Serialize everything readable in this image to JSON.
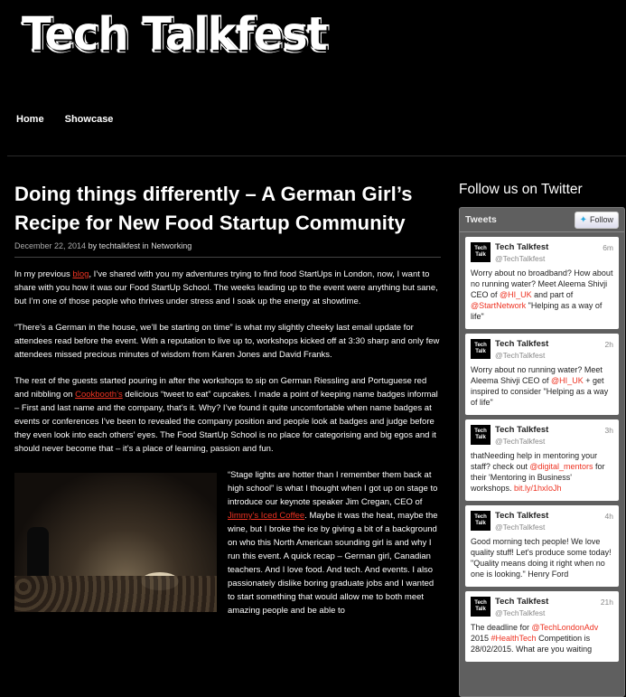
{
  "site": {
    "logo_text": "Tech Talkfest"
  },
  "nav": {
    "items": [
      "Home",
      "Showcase"
    ]
  },
  "post": {
    "title": "Doing things differently – A German Girl’s Recipe for New Food Startup Community",
    "date": "December 22, 2014",
    "by": "by",
    "author": "techtalkfest",
    "in": "in",
    "category": "Networking",
    "p1_a": "In my previous ",
    "p1_link": "blog",
    "p1_b": ", I’ve shared with you my adventures trying to find food StartUps in London, now, I want to share with you how it was our Food StartUp School. The weeks leading up to the event were anything but sane, but I’m one of those people who thrives under stress and I soak up the energy at showtime.",
    "p2": "“There’s a German in the house, we’ll be starting on time” is what my slightly cheeky last email update for attendees read before the event. With a reputation to live up to, workshops kicked off at 3:30 sharp and only few attendees missed precious minutes of wisdom from Karen Jones and David Franks.",
    "p3_a": "The rest of the guests started pouring in after the workshops to sip on German Riessling and Portuguese red and nibbling on ",
    "p3_link": "Cookbooth’s",
    "p3_b": " delicious “tweet to eat” cupcakes. I made a point of keeping name badges informal – First and last name and the company, that’s it. Why? I’ve found it quite uncomfortable when name badges at events or conferences I’ve been to revealed the company position and  people look at badges and judge before they even look into each others’ eyes. The Food StartUp School is no place for categorising and big egos and it should never become that – it’s a place of learning, passion and fun.",
    "p4_a": "“Stage lights are hotter than I remember them back at high school” is what I thought when I got up on stage to introduce our keynote speaker Jim Cregan, CEO of ",
    "p4_link": "Jimmy’s Iced Coffee",
    "p4_b": ". Maybe it was the heat, maybe the wine, but I broke the ice by giving a bit of a background on who this North American sounding girl is and why I run this event. A quick recap – German girl, Canadian teachers. And I love food. And tech. And events. I also passionately dislike boring graduate jobs and I wanted to start something that would allow me to both meet amazing people and be able to"
  },
  "sidebar": {
    "heading": "Follow us on Twitter",
    "widget_title": "Tweets",
    "follow_label": "Follow",
    "tweets": [
      {
        "name": "Tech Talkfest",
        "handle": "@TechTalkfest",
        "time": "6m",
        "t1": "Worry about no broadband? How about no running water? Meet Aleema Shivji CEO of ",
        "h1": "@HI_UK",
        "t2": " and part of ",
        "h2": "@StartNetwork",
        "t3": " \"Helping as a way of life\""
      },
      {
        "name": "Tech Talkfest",
        "handle": "@TechTalkfest",
        "time": "2h",
        "t1": "Worry about no running water? Meet Aleema Shivji CEO of ",
        "h1": "@HI_UK",
        "t2": " + get inspired to consider \"Helping as a way of life\"",
        "h2": "",
        "t3": ""
      },
      {
        "name": "Tech Talkfest",
        "handle": "@TechTalkfest",
        "time": "3h",
        "t1": "thatNeeding help in mentoring your staff? check out ",
        "h1": "@digital_mentors",
        "t2": " for their 'Mentoring in Business' workshops. ",
        "h2": "bit.ly/1hxIoJh",
        "t3": ""
      },
      {
        "name": "Tech Talkfest",
        "handle": "@TechTalkfest",
        "time": "4h",
        "t1": "Good morning tech people! We love quality stuff! Let's produce some today! \"Quality means doing it right when no one is looking.\" Henry Ford",
        "h1": "",
        "t2": "",
        "h2": "",
        "t3": ""
      },
      {
        "name": "Tech Talkfest",
        "handle": "@TechTalkfest",
        "time": "21h",
        "t1": "The deadline for ",
        "h1": "@TechLondonAdv",
        "t2": " 2015 ",
        "h2": "#HealthTech",
        "t3": " Competition is 28/02/2015. What are you waiting"
      }
    ]
  },
  "colors": {
    "accent": "#ee3322",
    "background": "#000000",
    "widget": "#5f5f5f"
  }
}
